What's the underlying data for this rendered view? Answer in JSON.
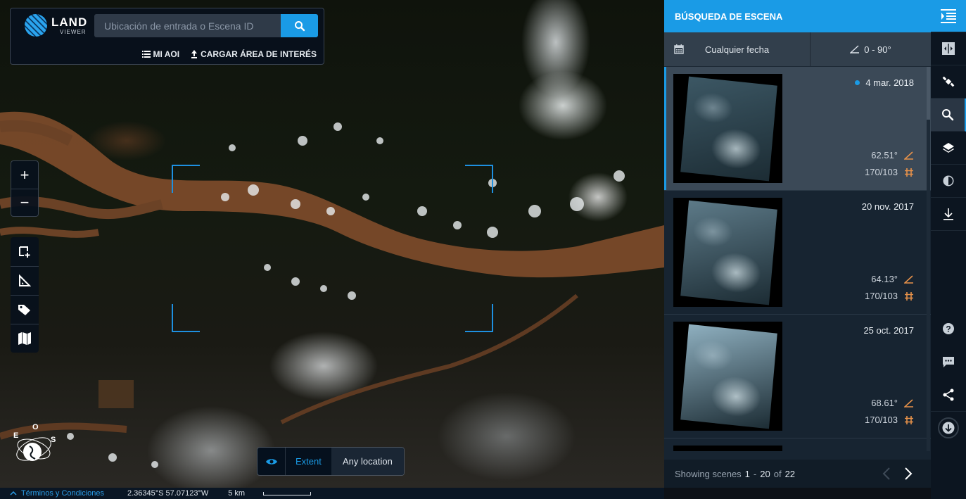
{
  "app": {
    "logo_main": "LAND",
    "logo_sub": "VIEWER"
  },
  "search": {
    "placeholder": "Ubicación de entrada o Escena ID",
    "value": "",
    "search_icon": "search-icon",
    "my_aoi_label": "MI AOI",
    "upload_aoi_label": "CARGAR ÁREA DE INTERÉS"
  },
  "map_controls": {
    "zoom_in": "+",
    "zoom_out": "−",
    "tools": [
      "area-select-icon",
      "ruler-icon",
      "tag-icon",
      "map-icon"
    ]
  },
  "extent_toggle": {
    "eye_icon": "eye-icon",
    "active_label": "Extent",
    "inactive_label": "Any location"
  },
  "status_bar": {
    "terms_label": "Términos y Condiciones",
    "coordinates": "2.36345°S 57.07123°W",
    "scale_label": "5 km"
  },
  "panel": {
    "title": "BÚSQUEDA DE ESCENA",
    "date_filter": "Cualquier fecha",
    "angle_filter": "0 - 90°",
    "scenes": [
      {
        "date": "4 mar. 2018",
        "sun_angle": "62.51°",
        "path_row": "170/103",
        "selected": true,
        "thumb_tone": "#3c5764"
      },
      {
        "date": "20 nov. 2017",
        "sun_angle": "64.13°",
        "path_row": "170/103",
        "selected": false,
        "thumb_tone": "#5d7a88"
      },
      {
        "date": "25 oct. 2017",
        "sun_angle": "68.61°",
        "path_row": "170/103",
        "selected": false,
        "thumb_tone": "#8fb0c0"
      }
    ],
    "pager": {
      "prefix": "Showing scenes",
      "from": "1",
      "dash": "-",
      "to": "20",
      "of": "of",
      "total": "22"
    }
  },
  "rail": {
    "top": [
      "collapse-panel-icon",
      "compare-icon",
      "satellite-icon",
      "search-icon",
      "layers-icon",
      "contrast-icon",
      "download-icon"
    ],
    "bottom": [
      "help-icon",
      "feedback-icon",
      "share-icon",
      "circle-download-icon"
    ]
  },
  "colors": {
    "accent": "#1a9be6",
    "meta_icon": "#e8924a",
    "panel_bg": "#172431",
    "selected_bg": "#3b4957"
  }
}
